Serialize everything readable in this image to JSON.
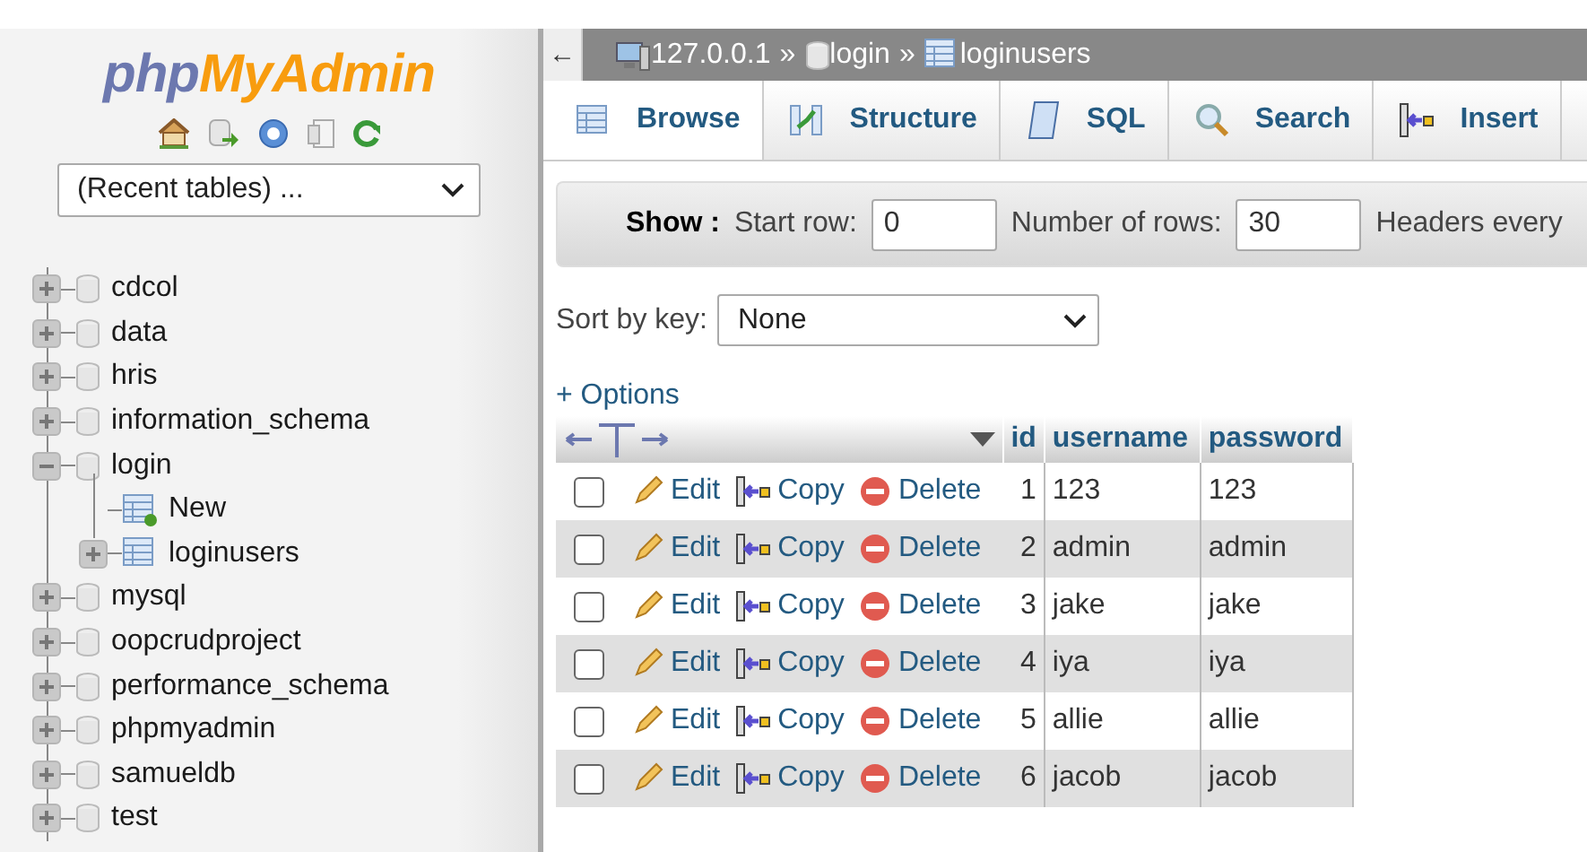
{
  "logo": {
    "first": "php",
    "second": "MyAdmin"
  },
  "recent_tables": {
    "value": "(Recent tables) ..."
  },
  "tree": [
    {
      "label": "cdcol",
      "kind": "database",
      "expanded": false
    },
    {
      "label": "data",
      "kind": "database",
      "expanded": false
    },
    {
      "label": "hris",
      "kind": "database",
      "expanded": false
    },
    {
      "label": "information_schema",
      "kind": "database",
      "expanded": false
    },
    {
      "label": "login",
      "kind": "database",
      "expanded": true,
      "children": [
        {
          "label": "New",
          "kind": "new"
        },
        {
          "label": "loginusers",
          "kind": "table",
          "expanded": false
        }
      ]
    },
    {
      "label": "mysql",
      "kind": "database",
      "expanded": false
    },
    {
      "label": "oopcrudproject",
      "kind": "database",
      "expanded": false
    },
    {
      "label": "performance_schema",
      "kind": "database",
      "expanded": false
    },
    {
      "label": "phpmyadmin",
      "kind": "database",
      "expanded": false
    },
    {
      "label": "samueldb",
      "kind": "database",
      "expanded": false
    },
    {
      "label": "test",
      "kind": "database",
      "expanded": false
    }
  ],
  "back_button": "←",
  "breadcrumb": [
    {
      "label": "127.0.0.1",
      "kind": "server"
    },
    {
      "label": "login",
      "kind": "database"
    },
    {
      "label": "loginusers",
      "kind": "table"
    }
  ],
  "breadcrumb_separator": "»",
  "tabs": [
    {
      "label": "Browse",
      "kind": "browse",
      "selected": true
    },
    {
      "label": "Structure",
      "kind": "structure",
      "selected": false
    },
    {
      "label": "SQL",
      "kind": "sql",
      "selected": false
    },
    {
      "label": "Search",
      "kind": "search",
      "selected": false
    },
    {
      "label": "Insert",
      "kind": "insert",
      "selected": false
    },
    {
      "kind": "more",
      "selected": false
    }
  ],
  "show_bar": {
    "title": "Show :",
    "start_row_label": "Start row:",
    "start_row": "0",
    "rows_label": "Number of rows:",
    "rows": "30",
    "headers_label": "Headers every"
  },
  "sort": {
    "label": "Sort by key:",
    "value": "None"
  },
  "options_link": "+ Options",
  "table": {
    "columns": [
      "id",
      "username",
      "password"
    ],
    "rows": [
      {
        "checked": false,
        "actions": [
          "Edit",
          "Copy",
          "Delete"
        ],
        "cells": [
          "1",
          "123",
          "123"
        ]
      },
      {
        "checked": false,
        "actions": [
          "Edit",
          "Copy",
          "Delete"
        ],
        "cells": [
          "2",
          "admin",
          "admin"
        ]
      },
      {
        "checked": false,
        "actions": [
          "Edit",
          "Copy",
          "Delete"
        ],
        "cells": [
          "3",
          "jake",
          "jake"
        ]
      },
      {
        "checked": false,
        "actions": [
          "Edit",
          "Copy",
          "Delete"
        ],
        "cells": [
          "4",
          "iya",
          "iya"
        ]
      },
      {
        "checked": false,
        "actions": [
          "Edit",
          "Copy",
          "Delete"
        ],
        "cells": [
          "5",
          "allie",
          "allie"
        ]
      },
      {
        "checked": false,
        "actions": [
          "Edit",
          "Copy",
          "Delete"
        ],
        "cells": [
          "6",
          "jacob",
          "jacob"
        ]
      }
    ]
  }
}
